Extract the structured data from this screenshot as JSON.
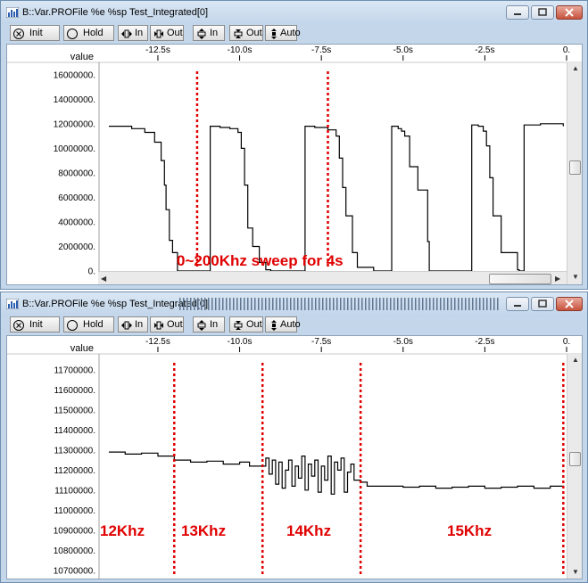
{
  "windows": [
    {
      "title": "B::Var.PROFile %e %sp Test_Integrated[0]",
      "toolbar": {
        "init": "Init",
        "hold": "Hold",
        "zoom_in_h": "In",
        "zoom_out_h": "Out",
        "zoom_in_v": "In",
        "zoom_out_v": "Out",
        "auto": "Auto"
      },
      "value_label": "value",
      "x_ticks": [
        "-12.5s",
        "-10.0s",
        "-7.5s",
        "-5.0s",
        "-2.5s",
        "0."
      ],
      "y_ticks": [
        "16000000.",
        "14000000.",
        "12000000.",
        "10000000.",
        "8000000.",
        "6000000.",
        "4000000.",
        "2000000.",
        "0."
      ],
      "annotation": "0~200Khz sweep for 4s"
    },
    {
      "title": "B::Var.PROFile %e %sp Test_Integrated[0]",
      "toolbar": {
        "init": "Init",
        "hold": "Hold",
        "zoom_in_h": "In",
        "zoom_out_h": "Out",
        "zoom_in_v": "In",
        "zoom_out_v": "Out",
        "auto": "Auto"
      },
      "value_label": "value",
      "x_ticks": [
        "-12.5s",
        "-10.0s",
        "-7.5s",
        "-5.0s",
        "-2.5s",
        "0."
      ],
      "y_ticks": [
        "11700000.",
        "11600000.",
        "11500000.",
        "11400000.",
        "11300000.",
        "11200000.",
        "11100000.",
        "11000000.",
        "10900000.",
        "10800000.",
        "10700000."
      ],
      "annotations": [
        "12Khz",
        "13Khz",
        "14Khz",
        "15Khz"
      ]
    }
  ],
  "colors": {
    "trace": "#000000",
    "marker": "#e00000",
    "annotation": "#e00000",
    "frame": "#c4d6e9"
  },
  "chart_data": [
    {
      "type": "line",
      "x_axis_unit": "s",
      "xlim": [
        -14.3,
        0
      ],
      "ylim": [
        0,
        17000000
      ],
      "series": [
        {
          "x": [
            -14.0,
            -13.3,
            -12.9,
            -12.6,
            -12.4,
            -12.3,
            -12.25,
            -12.15,
            -12.05,
            -11.9,
            -11.2,
            -10.9,
            -10.6,
            -10.3,
            -10.05,
            -9.95,
            -9.85,
            -9.75,
            -9.6,
            -9.4,
            -9.2,
            -9.05,
            -8.4,
            -8.0,
            -7.7,
            -7.3,
            -7.05,
            -6.95,
            -6.85,
            -6.75,
            -6.55,
            -6.4,
            -5.9,
            -5.7,
            -5.35,
            -5.15,
            -5.05,
            -4.95,
            -4.8,
            -4.55,
            -4.25,
            -4.2,
            -3.1,
            -2.9,
            -2.7,
            -2.55,
            -2.45,
            -2.35,
            -2.25,
            -2.0,
            -1.5,
            -1.45,
            -1.3,
            -0.8,
            -0.1
          ],
          "y": [
            11800000,
            11600000,
            11300000,
            10500000,
            9000000,
            7000000,
            5000000,
            2500000,
            1500000,
            0,
            0,
            11800000,
            11700000,
            11600000,
            11300000,
            10000000,
            7000000,
            3500000,
            2000000,
            700000,
            100000,
            0,
            0,
            11800000,
            11700000,
            11500000,
            11000000,
            9200000,
            6800000,
            4500000,
            1500000,
            300000,
            0,
            0,
            11800000,
            11600000,
            11400000,
            11000000,
            8500000,
            6600000,
            2400000,
            0,
            0,
            11900000,
            11800000,
            11400000,
            10200000,
            7600000,
            4500000,
            1500000,
            100000,
            0,
            11900000,
            12000000,
            11800000
          ]
        }
      ],
      "markers_x": [
        -11.3,
        -7.3
      ]
    },
    {
      "type": "line",
      "x_axis_unit": "s",
      "xlim": [
        -14.3,
        0
      ],
      "ylim": [
        10650000,
        11780000
      ],
      "series": [
        {
          "x": [
            -14.0,
            -13.5,
            -13.0,
            -12.5,
            -12.0,
            -11.5,
            -11.0,
            -10.5,
            -10.0,
            -9.7,
            -9.2,
            -9.1,
            -9.0,
            -8.9,
            -8.8,
            -8.7,
            -8.6,
            -8.5,
            -8.4,
            -8.3,
            -8.2,
            -8.1,
            -8.0,
            -7.9,
            -7.8,
            -7.7,
            -7.6,
            -7.5,
            -7.4,
            -7.3,
            -7.2,
            -7.1,
            -7.0,
            -6.9,
            -6.8,
            -6.7,
            -6.6,
            -6.5,
            -6.3,
            -6.1,
            -5.5,
            -5.0,
            -4.5,
            -4.0,
            -3.5,
            -3.0,
            -2.5,
            -2.0,
            -1.5,
            -1.0,
            -0.5,
            -0.1
          ],
          "y": [
            11290000,
            11280000,
            11285000,
            11270000,
            11250000,
            11240000,
            11245000,
            11230000,
            11240000,
            11220000,
            11260000,
            11180000,
            11250000,
            11130000,
            11240000,
            11110000,
            11200000,
            11250000,
            11120000,
            11220000,
            11160000,
            11270000,
            11100000,
            11230000,
            11170000,
            11250000,
            11090000,
            11220000,
            11150000,
            11270000,
            11080000,
            11240000,
            11200000,
            11260000,
            11090000,
            11190000,
            11230000,
            11150000,
            11140000,
            11120000,
            11120000,
            11115000,
            11120000,
            11110000,
            11115000,
            11120000,
            11110000,
            11115000,
            11120000,
            11110000,
            11120000,
            11115000
          ]
        }
      ],
      "markers_x": [
        -12.0,
        -9.3,
        -6.3,
        -0.1
      ]
    }
  ]
}
